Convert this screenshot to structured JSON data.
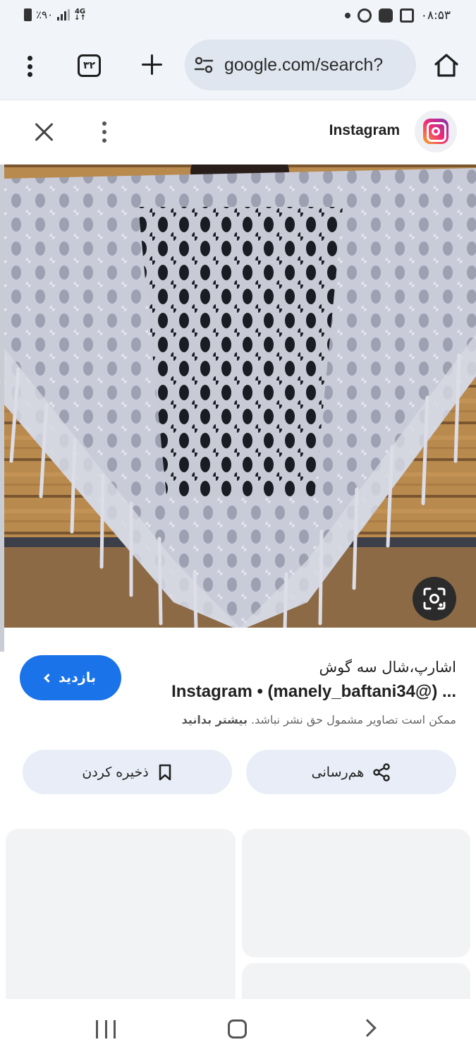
{
  "status_bar": {
    "battery": "٪۹۰",
    "network": "4G",
    "time": "۰۸:۵۳"
  },
  "toolbar": {
    "tab_count": "۳۲",
    "url": "google.com/search?"
  },
  "viewer": {
    "source_name": "Instagram"
  },
  "result": {
    "title": "اشارپ،شال سه گوش",
    "subtitle": "Instagram • (manely_baftani34@) ...",
    "copyright_note": "ممکن است تصاویر مشمول حق نشر نباشد.",
    "learn_more": "بیشتر بدانید",
    "visit_label": "بازدید"
  },
  "actions": {
    "share_label": "هم‌رسانی",
    "save_label": "ذخیره کردن"
  },
  "colors": {
    "accent": "#1a73e8",
    "chrome_bg": "#f1f4f9",
    "urlbar_bg": "#e0e6ef",
    "action_bg": "#e8edf7"
  }
}
